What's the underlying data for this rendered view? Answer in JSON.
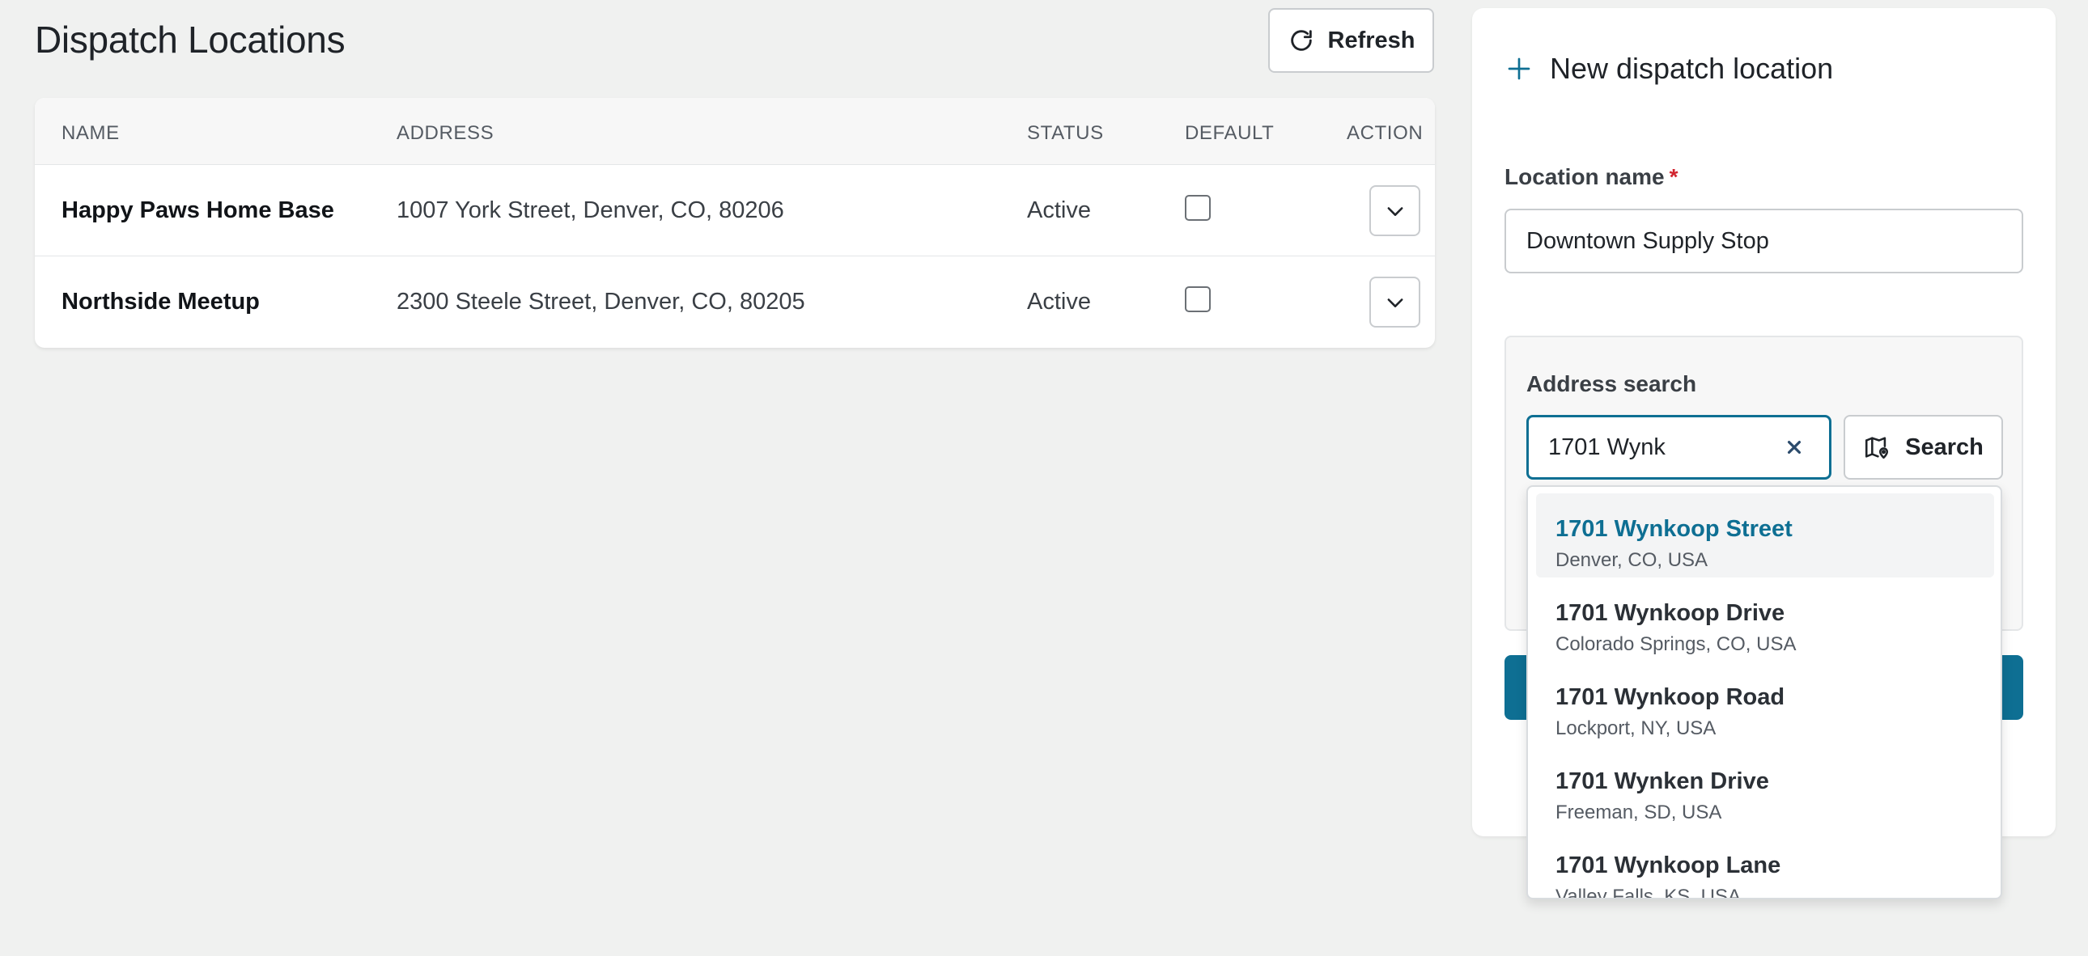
{
  "page": {
    "title": "Dispatch Locations",
    "refresh_label": "Refresh"
  },
  "table": {
    "headers": [
      "NAME",
      "ADDRESS",
      "STATUS",
      "DEFAULT",
      "ACTION"
    ],
    "rows": [
      {
        "name": "Happy Paws Home Base",
        "address": "1007 York Street, Denver, CO, 80206",
        "status": "Active",
        "default": false
      },
      {
        "name": "Northside Meetup",
        "address": "2300 Steele Street, Denver, CO, 80205",
        "status": "Active",
        "default": false
      }
    ]
  },
  "form": {
    "title": "New dispatch location",
    "location_label": "Location name",
    "required_mark": "*",
    "location_value": "Downtown Supply Stop",
    "address_label": "Address search",
    "address_query": "1701 Wynk",
    "search_label": "Search"
  },
  "suggestions": [
    {
      "title": "1701 Wynkoop Street",
      "subtitle": "Denver, CO, USA",
      "highlighted": true
    },
    {
      "title": "1701 Wynkoop Drive",
      "subtitle": "Colorado Springs, CO, USA"
    },
    {
      "title": "1701 Wynkoop Road",
      "subtitle": "Lockport, NY, USA"
    },
    {
      "title": "1701 Wynken Drive",
      "subtitle": "Freeman, SD, USA"
    },
    {
      "title": "1701 Wynkoop Lane",
      "subtitle": "Valley Falls, KS, USA"
    }
  ],
  "colors": {
    "accent": "#0e6f93",
    "required": "#d1242f",
    "background": "#f0f1f0"
  },
  "icons": {
    "refresh": "refresh-icon",
    "row_action": "chevron-down-icon",
    "add": "plus-icon",
    "clear": "close-icon",
    "search": "map-pin-icon"
  }
}
